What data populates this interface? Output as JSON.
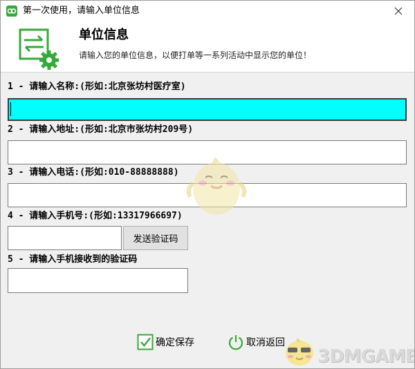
{
  "window": {
    "title": "第一次使用，请输入单位信息"
  },
  "header": {
    "title": "单位信息",
    "subtitle": "请输入您的单位信息，以便打单等一系列活动中显示您的单位！"
  },
  "form": {
    "name_label": "1 - 请输入名称:(形如:北京张坊村医疗室)",
    "name_value": "",
    "address_label": "2 - 请输入地址:(形如:北京市张坊村209号)",
    "address_value": "",
    "phone_label": "3 - 请输入电话:(形如:010-88888888)",
    "phone_value": "",
    "mobile_label": "4 - 请输入手机号:(形如:13317966697)",
    "mobile_value": "",
    "send_code_label": "发送验证码",
    "code_label": "5 - 请输入手机接收到的验证码",
    "code_value": ""
  },
  "actions": {
    "save_label": "确定保存",
    "cancel_label": "取消返回"
  },
  "watermark": {
    "text": "3DMGAME"
  },
  "colors": {
    "accent_green": "#37a83b",
    "active_field": "#00ffff"
  }
}
